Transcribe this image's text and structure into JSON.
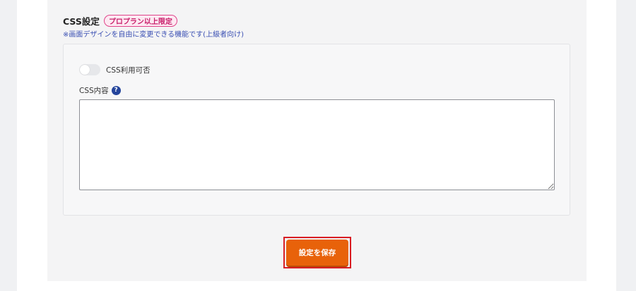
{
  "css_settings": {
    "title": "CSS設定",
    "plan_badge": "プロプラン以上限定",
    "note": "※画面デザインを自由に変更できる機能です(上級者向け)",
    "toggle": {
      "label": "CSS利用可否",
      "enabled": false
    },
    "content_label": "CSS内容",
    "help_icon": "question-circle-icon",
    "help_glyph": "?",
    "textarea_value": ""
  },
  "actions": {
    "save_label": "設定を保存"
  },
  "colors": {
    "badge_border": "#e0448a",
    "badge_bg": "#fde9f2",
    "note_text": "#3a4fb3",
    "help_icon": "#25459c",
    "save_button": "#e8620a",
    "highlight": "#d81d24"
  }
}
